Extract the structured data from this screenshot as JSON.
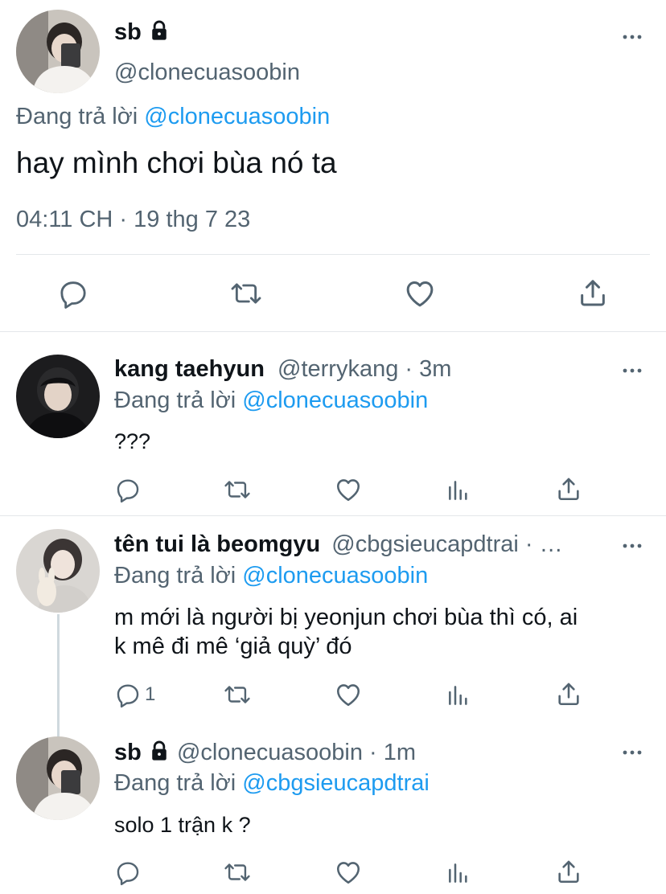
{
  "main_tweet": {
    "display_name": "sb",
    "handle": "@clonecuasoobin",
    "replying_prefix": "Đang trả lời",
    "replying_to": "@clonecuasoobin",
    "text": "hay mình chơi bùa nó ta",
    "timestamp": "04:11 CH · 19 thg 7 23"
  },
  "replies": [
    {
      "display_name": "kang taehyun",
      "handle_time": "@terrykang · 3m",
      "replying_prefix": "Đang trả lời",
      "replying_to": "@clonecuasoobin",
      "text": "???",
      "reply_count": ""
    },
    {
      "display_name": "tên tui là beomgyu",
      "handle_time": "@cbgsieucapdtrai · …",
      "replying_prefix": "Đang trả lời",
      "replying_to": "@clonecuasoobin",
      "text_line1": "m mới là người bị yeonjun chơi bùa thì có, ai",
      "text_line2": "k mê đi mê ‘giả quỳ’ đó",
      "reply_count": "1"
    },
    {
      "display_name": "sb",
      "handle_time": "@clonecuasoobin · 1m",
      "replying_prefix": "Đang trả lời",
      "replying_to": "@cbgsieucapdtrai",
      "text": "solo 1 trận k ?",
      "reply_count": ""
    }
  ],
  "colors": {
    "link": "#1d9bf0",
    "secondary": "#536471",
    "primary": "#0f1419",
    "divider": "#e4e7ea"
  },
  "icons": [
    "lock-icon",
    "more-icon",
    "reply-icon",
    "retweet-icon",
    "like-icon",
    "share-icon",
    "views-icon"
  ]
}
